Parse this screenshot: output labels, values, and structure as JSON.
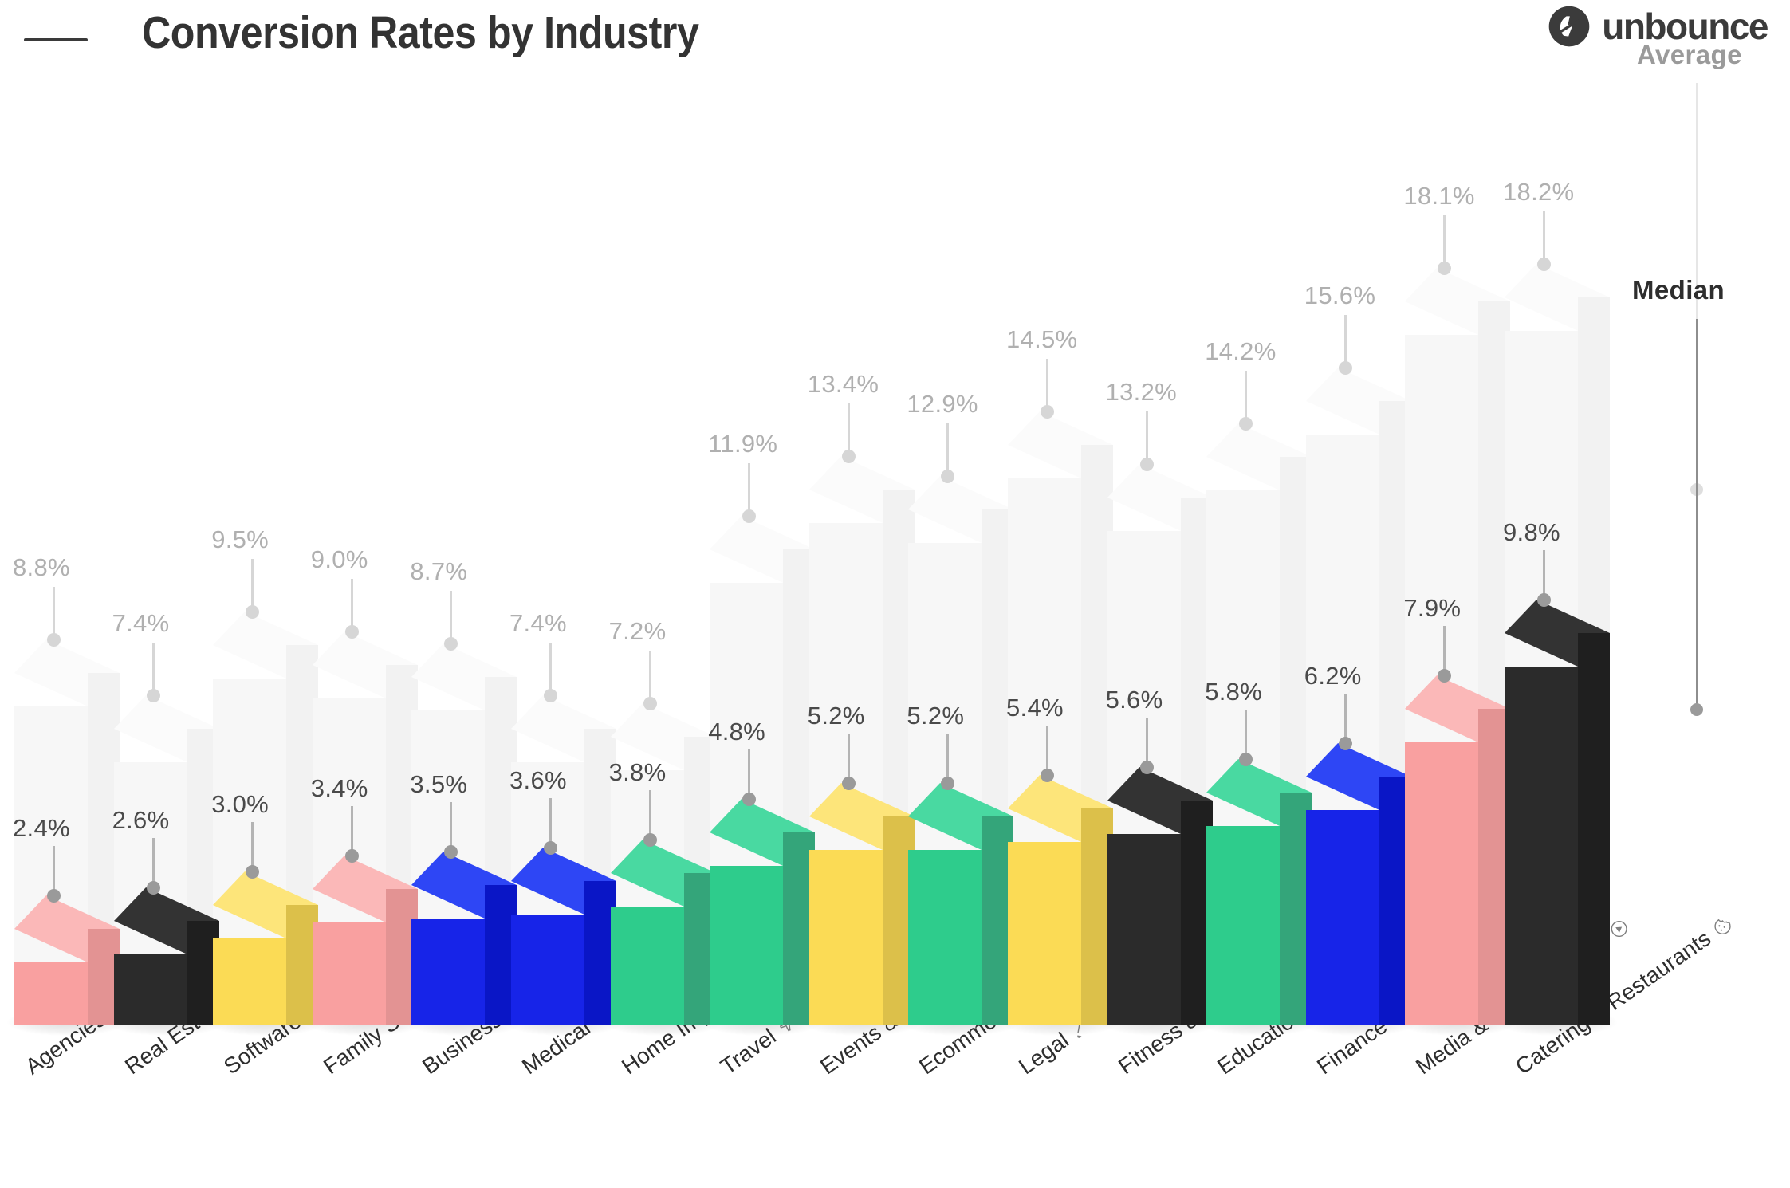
{
  "header": {
    "title": "Conversion Rates by Industry",
    "brand": "unbounce",
    "brand_icon": "unbounce-logo-icon"
  },
  "legend": {
    "average_label": "Average",
    "median_label": "Median",
    "average_color": "#9a9a9a",
    "median_color": "#2e2e2e"
  },
  "palette": {
    "pink": "#F9A0A0",
    "black": "#2B2B2B",
    "yellow": "#FBDB55",
    "blue": "#1724E8",
    "green": "#2ECC8C",
    "average_gray": "#F4F4F4"
  },
  "chart_data": {
    "type": "bar",
    "title": "Conversion Rates by Industry",
    "xlabel": "",
    "ylabel": "",
    "ylim": [
      0,
      18.2
    ],
    "grid": false,
    "legend_position": "right",
    "unit": "%",
    "categories": [
      "Agencies",
      "Real Estate",
      "Software as a Service",
      "Family Support",
      "Business Services",
      "Medical Services",
      "Home Improvement",
      "Travel",
      "Events & Leisure",
      "Ecommerce",
      "Legal",
      "Fitness & Nutrition",
      "Education",
      "Finance & Insurance",
      "Media & Entertainment",
      "Catering & Restaurants"
    ],
    "category_icons": [
      "megaphone-icon",
      "house-icon",
      "gear-icon",
      "family-icon",
      "briefcase-icon",
      "face-mask-icon",
      "armchair-icon",
      "airplane-icon",
      "calendar-check-icon",
      "shopping-cart-icon",
      "gavel-icon",
      "footprints-icon",
      "open-book-icon",
      "dollar-coin-icon",
      "play-button-icon",
      "cookie-icon"
    ],
    "series": [
      {
        "name": "Median",
        "values": [
          2.4,
          2.6,
          3.0,
          3.4,
          3.5,
          3.6,
          3.8,
          4.8,
          5.2,
          5.2,
          5.4,
          5.6,
          5.8,
          6.2,
          7.9,
          9.8
        ],
        "labels": [
          "2.4%",
          "2.6%",
          "3.0%",
          "3.4%",
          "3.5%",
          "3.6%",
          "3.8%",
          "4.8%",
          "5.2%",
          "5.2%",
          "5.4%",
          "5.6%",
          "5.8%",
          "6.2%",
          "7.9%",
          "9.8%"
        ],
        "colors": [
          "pink",
          "black",
          "yellow",
          "pink",
          "blue",
          "blue",
          "green",
          "green",
          "yellow",
          "green",
          "yellow",
          "black",
          "green",
          "blue",
          "pink",
          "black"
        ]
      },
      {
        "name": "Average",
        "values": [
          8.8,
          7.4,
          9.5,
          9.0,
          8.7,
          7.4,
          7.2,
          11.9,
          13.4,
          12.9,
          14.5,
          13.2,
          14.2,
          15.6,
          18.1,
          18.2
        ],
        "labels": [
          "8.8%",
          "7.4%",
          "9.5%",
          "9.0%",
          "8.7%",
          "7.4%",
          "7.2%",
          "11.9%",
          "13.4%",
          "12.9%",
          "14.5%",
          "13.2%",
          "14.2%",
          "15.6%",
          "18.1%",
          "18.2%"
        ],
        "colors": [
          "average_gray"
        ]
      }
    ]
  }
}
